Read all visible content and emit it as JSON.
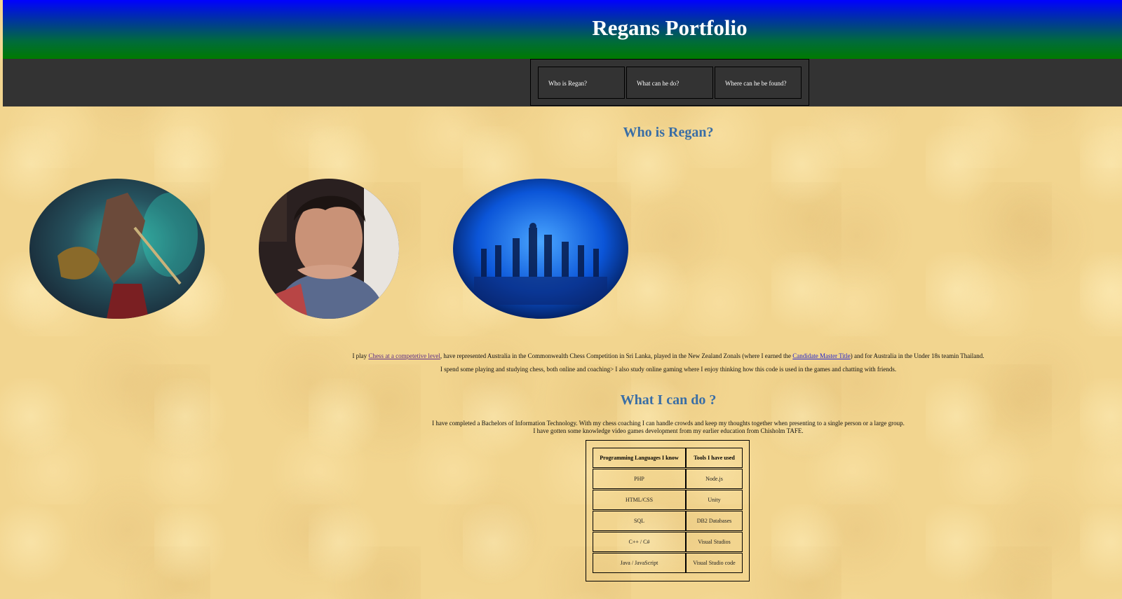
{
  "header": {
    "title": "Regans Portfolio"
  },
  "nav": {
    "items": [
      {
        "label": "Who is Regan?"
      },
      {
        "label": "What can he do?"
      },
      {
        "label": "Where can he be found?"
      }
    ]
  },
  "who": {
    "heading": "Who is Regan?",
    "images": [
      {
        "icon": "fantasy-warrior-image"
      },
      {
        "icon": "portrait-photo"
      },
      {
        "icon": "chess-pieces-image"
      }
    ],
    "para1_pre": "I play ",
    "para1_link1": "Chess at a competetive level",
    "para1_mid": ", have represented Australia in the Commonwealth Chess Competition in Sri Lanka, played in the New Zealand Zonals (where I earned the ",
    "para1_link2": "Candidate Master Title",
    "para1_post": ") and for Australia in the Under 18s teamin Thailand.",
    "para2": "I spend some playing and studying chess, both online and coaching> I also study online gaming where I enjoy thinking how this code is used in the games and chatting with friends."
  },
  "what": {
    "heading": "What I can do ?",
    "line1": "I have completed a Bachelors of Information Technology. With my chess coaching I can handle crowds and keep my thoughts together when presenting to a single person or a large group.",
    "line2": "I have gotten some knowledge video games development from my earlier education from Chisholm TAFE.",
    "table": {
      "headers": [
        "Programming Languages I know",
        "Tools I have used"
      ],
      "rows": [
        [
          "PHP",
          "Node.js"
        ],
        [
          "HTML/CSS",
          "Unity"
        ],
        [
          "SQL",
          "DB2 Databases"
        ],
        [
          "C++ / C#",
          "Visual Studios"
        ],
        [
          "Java / JavaScript",
          "Visual Studio code"
        ]
      ]
    }
  },
  "colors": {
    "header_top": "#0000ff",
    "header_bottom": "#007a00",
    "navbar": "#333333",
    "heading": "#3a6ea5",
    "background": "#f2d58f"
  }
}
